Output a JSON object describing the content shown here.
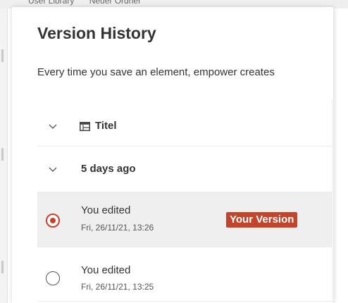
{
  "background": {
    "breadcrumb": [
      "User Library",
      "Neuer Ordner"
    ]
  },
  "dialog": {
    "title": "Version History",
    "description": "Every time you save an element, empower creates"
  },
  "element": {
    "icon": "table-icon",
    "name": "Titel"
  },
  "groups": [
    {
      "label": "5 days ago",
      "versions": [
        {
          "name": "You edited",
          "date": "Fri, 26/11/21, 13:26",
          "selected": true,
          "badge": "Your Version"
        },
        {
          "name": "You edited",
          "date": "Fri, 26/11/21, 13:25",
          "selected": false
        }
      ]
    }
  ],
  "colors": {
    "accent": "#c0452a",
    "selected_row": "#efefef"
  }
}
